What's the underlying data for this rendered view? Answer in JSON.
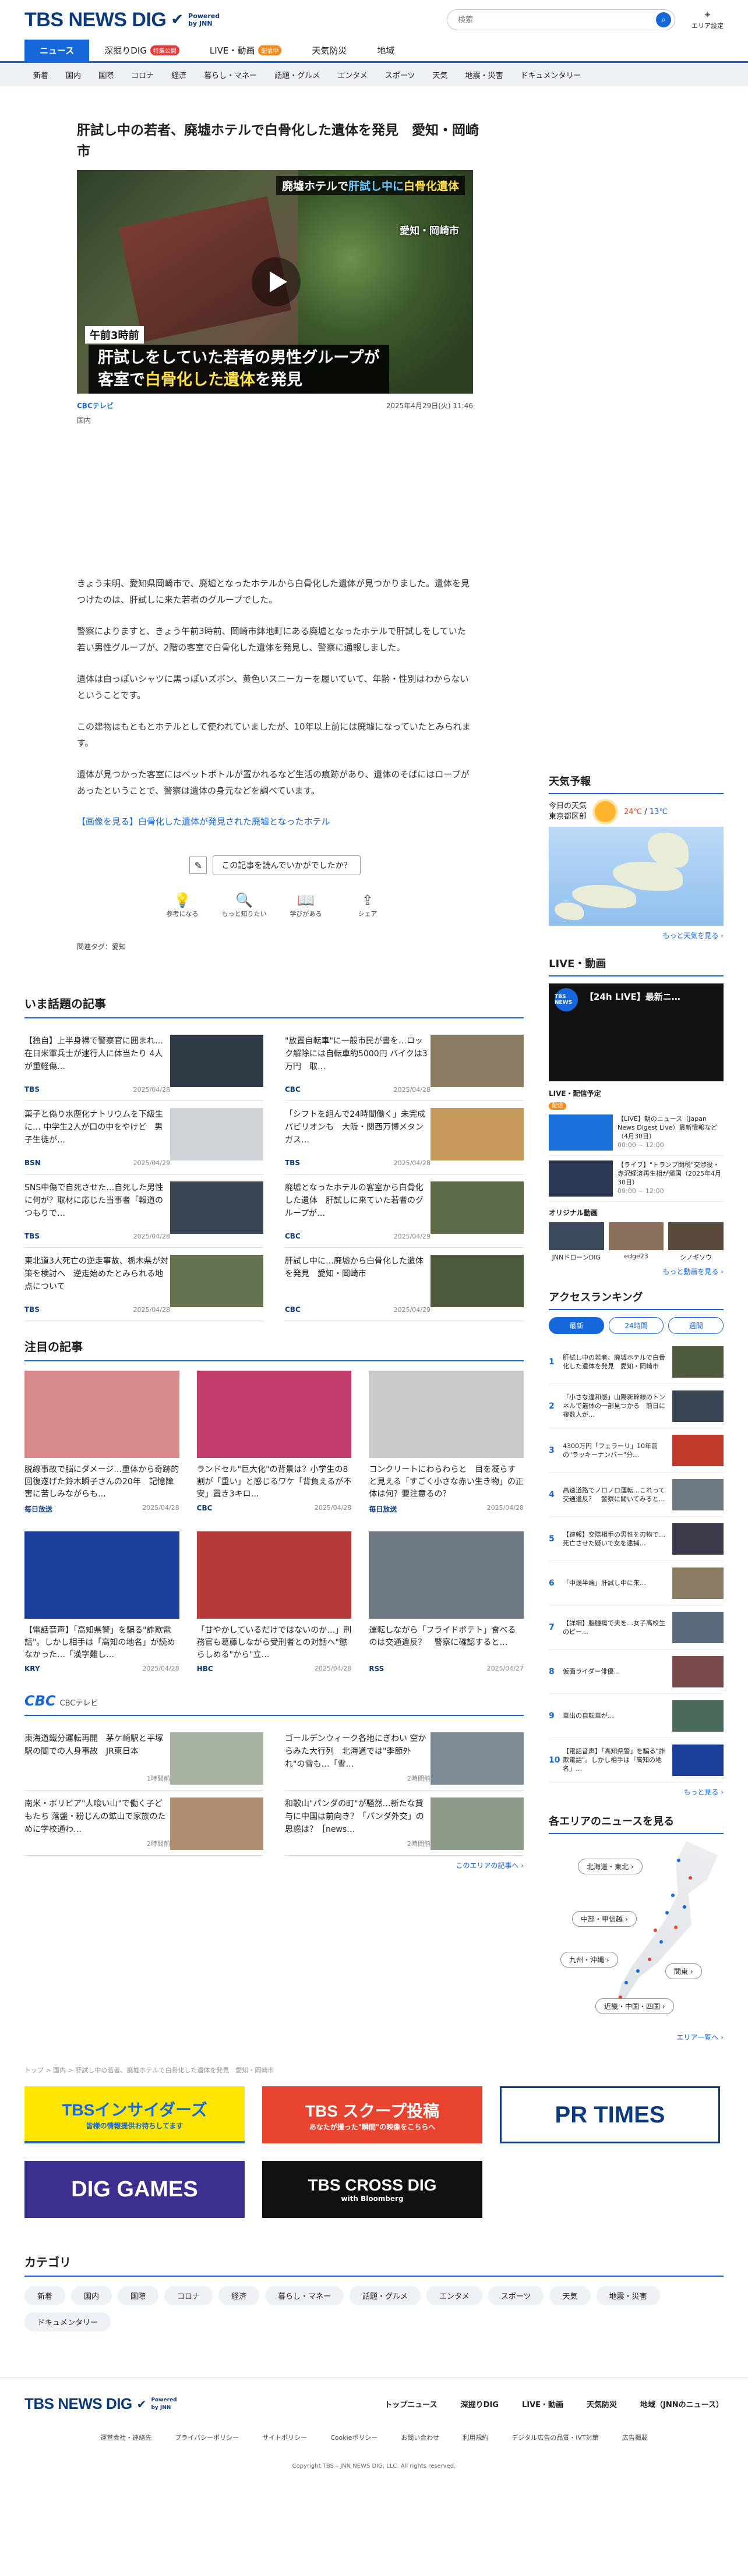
{
  "header": {
    "logo": "TBS NEWS DIG",
    "powered": "Powered",
    "by": "by JNN",
    "search_placeholder": "検索",
    "area": "エリア設定"
  },
  "gnav": [
    {
      "label": "ニュース",
      "badge": ""
    },
    {
      "label": "深掘りDIG",
      "badge": "特集公開"
    },
    {
      "label": "LIVE・動画",
      "badge": "配信中"
    },
    {
      "label": "天気防災",
      "badge": ""
    },
    {
      "label": "地域",
      "badge": ""
    }
  ],
  "catnav": [
    "新着",
    "国内",
    "国際",
    "コロナ",
    "経済",
    "暮らし・マネー",
    "話題・グルメ",
    "エンタメ",
    "スポーツ",
    "天気",
    "地震・災害",
    "ドキュメンタリー"
  ],
  "article": {
    "title": "肝試し中の若者、廃墟ホテルで白骨化した遺体を発見　愛知・岡崎市",
    "hero": {
      "cap1_a": "廃墟ホテルで",
      "cap1_b": "肝試し中に",
      "cap1_c": "白骨化遺体",
      "loc": "愛知・岡崎市",
      "time": "午前3時前",
      "sub1": "肝試しをしていた若者の男性グループが",
      "sub2_a": "客室で",
      "sub2_b": "白骨化した遺体",
      "sub2_c": "を発見"
    },
    "source": "CBCテレビ",
    "date": "2025年4月29日(火) 11:46",
    "genre": "国内",
    "body": [
      "きょう未明、愛知県岡崎市で、廃墟となったホテルから白骨化した遺体が見つかりました。遺体を見つけたのは、肝試しに来た若者のグループでした。",
      "警察によりますと、きょう午前3時前、岡崎市鉢地町にある廃墟となったホテルで肝試しをしていた若い男性グループが、2階の客室で白骨化した遺体を発見し、警察に通報しました。",
      "遺体は白っぽいシャツに黒っぽいズボン、黄色いスニーカーを履いていて、年齢・性別はわからないということです。",
      "この建物はもともとホテルとして使われていましたが、10年以上前には廃墟になっていたとみられます。",
      "遺体が見つかった客室にはペットボトルが置かれるなど生活の痕跡があり、遺体のそばにはロープがあったということで、警察は遺体の身元などを調べています。"
    ],
    "photo_link": "【画像を見る】白骨化した遺体が発見された廃墟となったホテル",
    "feedback_q": "この記事を読んでいかがでしたか？",
    "feedback": [
      {
        "icon": "💡",
        "label": "参考になる"
      },
      {
        "icon": "🔍",
        "label": "もっと知りたい"
      },
      {
        "icon": "📖",
        "label": "学びがある"
      },
      {
        "icon": "⇪",
        "label": "シェア"
      }
    ],
    "tags": "関連タグ：愛知"
  },
  "topics": {
    "title": "いま話題の記事",
    "items": [
      {
        "t": "【独自】上半身裸で警察官に囲まれ…在日米軍兵士が逮行人に体当たり 4人が重軽傷…",
        "src": "TBS",
        "d": "2025/04/28",
        "c": "#2f3a47"
      },
      {
        "t": "\"放置自転車\"に一般市民が書を…ロック解除には自転車約5000円 バイクは3万円　取…",
        "src": "CBC",
        "d": "2025/04/28",
        "c": "#8a7b62"
      },
      {
        "t": "菓子と偽り水塵化ナトリウムを下級生に… 中学生2人が口の中をやけど　男子生徒が…",
        "src": "BSN",
        "d": "2025/04/29",
        "c": "#cfd3d8"
      },
      {
        "t": "「シフトを組んで24時間働く」未完成パビリオンも　大阪・関西万博メタンガス…",
        "src": "TBS",
        "d": "2025/04/28",
        "c": "#c59a5a"
      },
      {
        "t": "SNS中傷で自死させた…自死した男性に何が？取材に応じた当事者「報道のつもりで…",
        "src": "TBS",
        "d": "2025/04/28",
        "c": "#3b4654"
      },
      {
        "t": "廃墟となったホテルの客室から白骨化した遺体　肝試しに来ていた若者のグループが…",
        "src": "CBC",
        "d": "2025/04/29",
        "c": "#5d6a47"
      },
      {
        "t": "東北道3人死亡の逆走事故、栃木県が対策を検討へ　逆走始めたとみられる地点について",
        "src": "TBS",
        "d": "2025/04/28",
        "c": "#63714f"
      },
      {
        "t": "肝試し中に…廃墟から白骨化した遺体を発見　愛知・岡崎市",
        "src": "CBC",
        "d": "2025/04/29",
        "c": "#4c5a3b"
      }
    ]
  },
  "featured": {
    "title": "注目の記事",
    "items": [
      {
        "t": "脱線事故で脳にダメージ…重体から奇跡的回復遂げた鈴木瞬子さんの20年　記憶障害に苦しみながらも…",
        "src": "毎日放送",
        "d": "2025/04/28",
        "c": "#d98a8a"
      },
      {
        "t": "ランドセル\"巨大化\"の背景は？小学生の8割が「重い」と感じるワケ「背負えるが不安」置き3キロ…",
        "src": "CBC",
        "d": "2025/04/28",
        "c": "#c23c6e"
      },
      {
        "t": "コンクリートにわらわらと　目を凝らすと見える「すごく小さな赤い生き物」の正体は何？要注意るの？",
        "src": "毎日放送",
        "d": "2025/04/28",
        "c": "#c9c9c9"
      },
      {
        "t": "【電話音声】「高知県警」を騙る\"詐欺電話\"。しかし相手は「高知の地名」が読めなかった…「漢字難し…",
        "src": "KRY",
        "d": "2025/04/28",
        "c": "#1b3f9a"
      },
      {
        "t": "「甘やかしているだけではないのか…」刑務官も葛藤しながら受刑者との対話へ\"懲らしめる\"から\"立…",
        "src": "HBC",
        "d": "2025/04/28",
        "c": "#b53a3a"
      },
      {
        "t": "運転しながら「フライドポテト」食べるのは交通違反？　警察に確認すると…",
        "src": "RSS",
        "d": "2025/04/27",
        "c": "#6e7880"
      }
    ]
  },
  "cbc": {
    "title": "CBCテレビ",
    "items": [
      {
        "t": "東海道鐵分運転再開　茅ケ崎駅と平塚駅の間での人身事故　JR東日本",
        "d": "1時間前",
        "c": "#a9b3a4"
      },
      {
        "t": "ゴールデンウィーク各地にぎわい 空からみた大行列　北海道では\"季節外れ\"の雪も…「雪…",
        "d": "2時間前",
        "c": "#7d8b96"
      },
      {
        "t": "南米・ボリビア\"人喰い山\"で働く子どもたち 落盤・粉じんの鉱山で家族のために学校通わ…",
        "d": "2時間前",
        "c": "#b08e72"
      },
      {
        "t": "和歌山\"パンダの町\"が騒然…新たな貸与に中国は前向き？「パンダ外交」の思惑は？［news…",
        "d": "2時間前",
        "c": "#8f9b8a"
      }
    ],
    "more": "このエリアの記事へ ›"
  },
  "crumb": "トップ > 国内 > 肝試し中の若者、廃墟ホテルで白骨化した遺体を発見　愛知・岡崎市",
  "banners": [
    {
      "text": "TBSインサイダーズ",
      "sub": "皆様の情報提供お待ちしてます",
      "bg": "#ffe600",
      "fg": "#1667d9"
    },
    {
      "text": "TBS スクープ投稿",
      "sub": "あなたが撮った\"瞬間\"の映像をこちらへ",
      "bg": "#e8432e",
      "fg": "#ffffff"
    },
    {
      "text": "PR TIMES",
      "sub": "",
      "bg": "#ffffff",
      "fg": "#0b3a7e"
    },
    {
      "text": "DIG GAMES",
      "sub": "",
      "bg": "#3b2f8f",
      "fg": "#ffffff"
    },
    {
      "text": "TBS CROSS DIG",
      "sub": "with Bloomberg",
      "bg": "#111111",
      "fg": "#ffffff"
    }
  ],
  "categories": {
    "title": "カテゴリ",
    "items": [
      "新着",
      "国内",
      "国際",
      "コロナ",
      "経済",
      "暮らし・マネー",
      "話題・グルメ",
      "エンタメ",
      "スポーツ",
      "天気",
      "地震・災害",
      "ドキュメンタリー"
    ]
  },
  "footer": {
    "links": [
      "トップニュース",
      "深掘りDIG",
      "LIVE・動画",
      "天気防災",
      "地域（JNNのニュース）"
    ],
    "sub": [
      "運営会社・連絡先",
      "プライバシーポリシー",
      "サイトポリシー",
      "Cookieポリシー",
      "お問い合わせ",
      "利用規約",
      "デジタル広告の品質・IVT対策",
      "広告掲載"
    ],
    "copy": "Copyright TBS – JNN NEWS DIG, LLC. All rights reserved."
  },
  "side": {
    "weather": {
      "title": "天気予報",
      "label1": "今日の天気",
      "label2": "東京都区部",
      "temp_hi": "24℃",
      "temp_lo": "13℃",
      "more": "もっと天気を見る ›"
    },
    "live": {
      "title": "LIVE・動画",
      "video_title": "【24h LIVE】最新ニ…",
      "channel": "TBS NEWS",
      "sub": "LIVE・配信予定",
      "badge": "配信",
      "items": [
        {
          "t": "【LIVE】朝のニュース（Japan News Digest Live）最新情報など（4月30日）",
          "d": "00:00 ~ 12:00"
        },
        {
          "t": "【ライブ】\"トランプ関税\"交渉役・赤沢経済再生相が帰国（2025年4月30日）",
          "d": "09:00 ~ 12:00"
        }
      ],
      "orig_title": "オリジナル動画",
      "orig": [
        "JNNドローンDIG",
        "edge23",
        "シノギソウ"
      ],
      "more": "もっと動画を見る ›"
    },
    "ranking": {
      "title": "アクセスランキング",
      "tabs": [
        "最新",
        "24時間",
        "週間"
      ],
      "items": [
        "肝試し中の若者、廃墟ホテルで白骨化した遺体を発見　愛知・岡崎市",
        "「小さな違和感」山陽新幹線のトンネルで遺体の一部見つかる　前日に複数人が…",
        "4300万円「フェラーリ」10年前の\"ラッキーナンバー\"分…",
        "高速道路でノロノロ運転…これって交通違反？　警察に聞いてみると…",
        "【速報】交際相手の男性を刃物で…死亡させた疑いで女を逮捕…",
        "「中途半端」肝試し中に来…",
        "【詳細】脳腫瘍で夫を…女子高校生のピー…",
        "仮面ライダー俳優…",
        "車出の自転車が…",
        "【電話音声】「高知県警」を騙る\"詐欺電話\"。しかし相手は「高知の地名」…"
      ],
      "more": "もっと見る ›"
    },
    "area": {
      "title": "各エリアのニュースを見る",
      "buttons": [
        "北海道・東北 ›",
        "中部・甲信越 ›",
        "九州・沖縄 ›",
        "関東 ›",
        "近畿・中国・四国 ›"
      ],
      "more": "エリア一覧へ ›"
    }
  }
}
